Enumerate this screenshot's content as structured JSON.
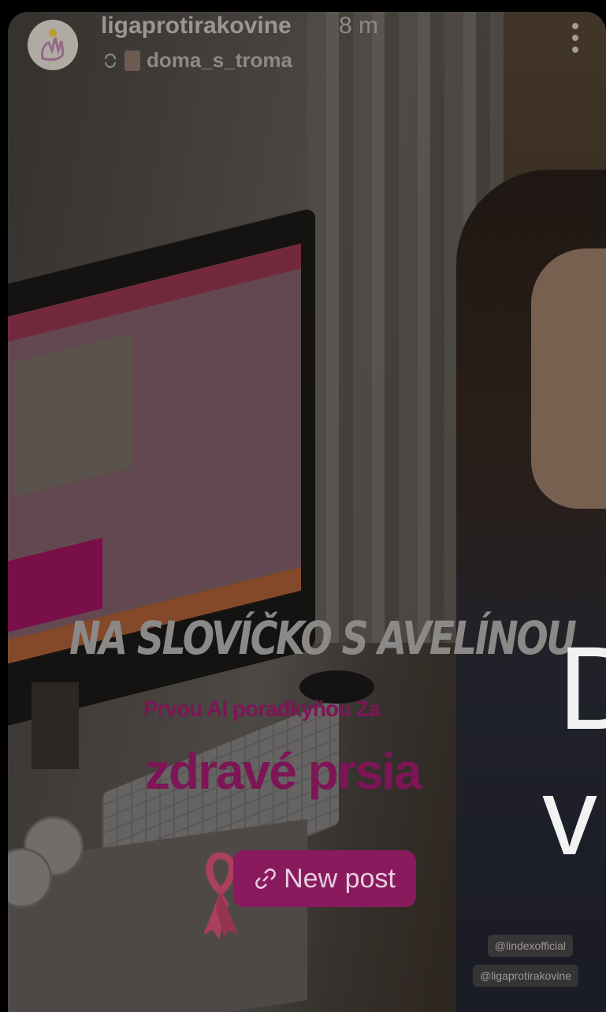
{
  "header": {
    "username": "ligaprotirakovine",
    "time": "8 m",
    "repost_username": "doma_s_troma"
  },
  "overlay": {
    "headline": "NA SLOVÍČKO S AVELÍNOU",
    "subtitle_line1": "Prvou AI poradkyňou Za",
    "subtitle_line2": "zdravé prsia",
    "big_letter_1": "D",
    "big_letter_2": "v"
  },
  "new_post": {
    "label": "New post",
    "icon": "link-icon"
  },
  "tags": [
    "@lindexofficial",
    "@ligaprotirakovine"
  ],
  "colors": {
    "accent": "#8a1a5e",
    "subtitle": "#7d1556"
  }
}
